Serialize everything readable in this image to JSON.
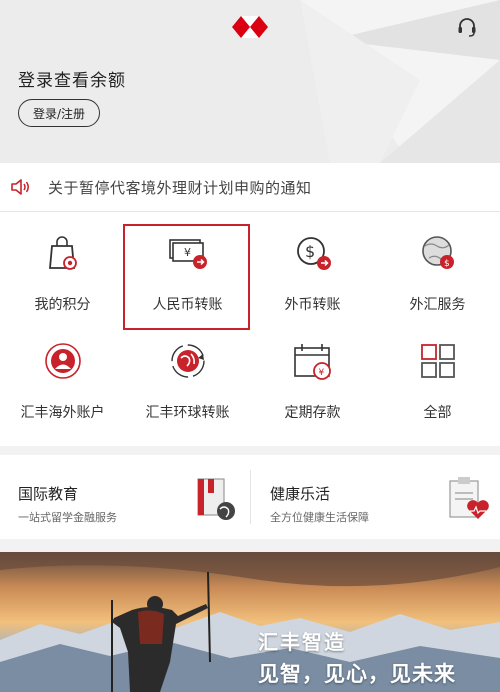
{
  "header": {
    "login_prompt": "登录查看余额",
    "login_button": "登录/注册",
    "brand_color": "#db0011"
  },
  "notice": {
    "text": "关于暂停代客境外理财计划申购的通知",
    "icon": "speaker-icon"
  },
  "services": [
    {
      "label": "我的积分",
      "icon": "points-bag-icon"
    },
    {
      "label": "人民币转账",
      "icon": "rmb-transfer-icon",
      "highlighted": true
    },
    {
      "label": "外币转账",
      "icon": "foreign-transfer-icon"
    },
    {
      "label": "外汇服务",
      "icon": "fx-globe-icon"
    },
    {
      "label": "汇丰海外账户",
      "icon": "overseas-account-icon"
    },
    {
      "label": "汇丰环球转账",
      "icon": "global-transfer-icon"
    },
    {
      "label": "定期存款",
      "icon": "time-deposit-icon"
    },
    {
      "label": "全部",
      "icon": "grid-all-icon"
    }
  ],
  "cards": [
    {
      "title": "国际教育",
      "subtitle": "一站式留学金融服务",
      "icon": "education-book-icon"
    },
    {
      "title": "健康乐活",
      "subtitle": "全方位健康生活保障",
      "icon": "health-clipboard-icon"
    }
  ],
  "banner": {
    "line1": "汇丰智造",
    "line2": "见智，见心，见未来"
  },
  "colors": {
    "accent_red": "#c8222a",
    "background": "#f2f2f2"
  }
}
